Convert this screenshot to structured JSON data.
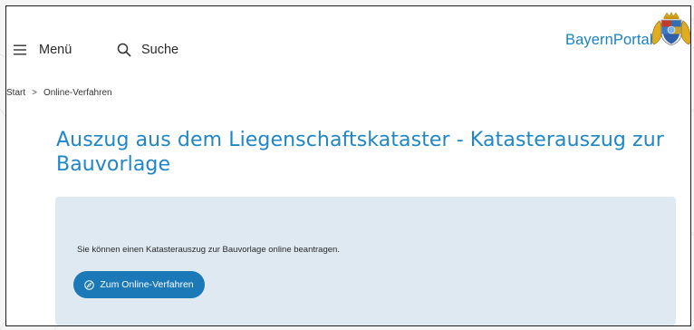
{
  "header": {
    "menu_label": "Menü",
    "search_label": "Suche",
    "logo_text": "BayernPortal"
  },
  "breadcrumb": {
    "items": [
      "Start",
      "Online-Verfahren"
    ],
    "separator": ">"
  },
  "main": {
    "title": "Auszug aus dem Liegenschaftskataster - Katasterauszug zur Bauvorlage",
    "info_text": "Sie können einen Katasterauszug zur Bauvorlage online beantragen.",
    "cta_label": "Zum Online-Verfahren"
  },
  "icons": {
    "menu": "hamburger-menu-icon",
    "search": "magnifier-icon",
    "cta": "compass-icon",
    "coat_of_arms": "bavarian-coat-of-arms"
  },
  "colors": {
    "accent": "#1f86c8",
    "button": "#1b79b8",
    "info_box": "#dfe9f2"
  }
}
